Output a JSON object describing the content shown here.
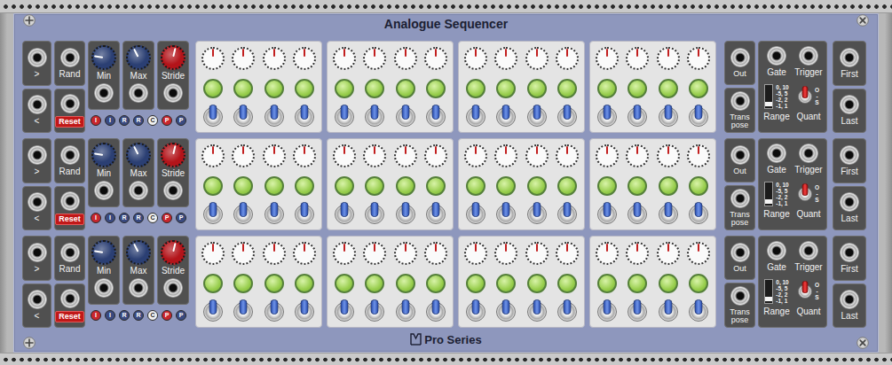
{
  "module": {
    "title": "Analogue Sequencer",
    "footer": "Pro Series"
  },
  "channels": [
    {
      "inputs": [
        {
          "label": ">"
        },
        {
          "label": "<"
        }
      ],
      "controls": [
        {
          "label": "Rand",
          "kind": "plain"
        },
        {
          "label": "Reset",
          "kind": "pill"
        }
      ],
      "knobs": [
        {
          "label": "Min",
          "level": 0.2,
          "color": "#2b3f73"
        },
        {
          "label": "Max",
          "level": 0.4,
          "color": "#2b3f73"
        },
        {
          "label": "Stride",
          "level": 0.55,
          "color": "#b3141a"
        }
      ],
      "indicators": [
        {
          "label": "I",
          "color": "#c8262d"
        },
        {
          "label": "I",
          "color": "#3a4a80"
        },
        {
          "label": "R",
          "color": "#3a4a80"
        },
        {
          "label": "R",
          "color": "#3a4a80"
        },
        {
          "label": "C",
          "color": "#f2f2f2"
        },
        {
          "label": "P",
          "color": "#c8262d"
        },
        {
          "label": "P",
          "color": "#3a4a80"
        }
      ],
      "groups": [
        {
          "steps": [
            {
              "level": 0.5,
              "lit": true,
              "switch": "up"
            },
            {
              "level": 0.5,
              "lit": true,
              "switch": "up"
            },
            {
              "level": 0.5,
              "lit": true,
              "switch": "up"
            },
            {
              "level": 0.5,
              "lit": true,
              "switch": "up"
            }
          ]
        },
        {
          "steps": [
            {
              "level": 0.5,
              "lit": true,
              "switch": "up"
            },
            {
              "level": 0.5,
              "lit": true,
              "switch": "up"
            },
            {
              "level": 0.5,
              "lit": true,
              "switch": "up"
            },
            {
              "level": 0.5,
              "lit": true,
              "switch": "up"
            }
          ]
        },
        {
          "steps": [
            {
              "level": 0.5,
              "lit": true,
              "switch": "up"
            },
            {
              "level": 0.5,
              "lit": true,
              "switch": "up"
            },
            {
              "level": 0.5,
              "lit": true,
              "switch": "up"
            },
            {
              "level": 0.5,
              "lit": true,
              "switch": "up"
            }
          ]
        },
        {
          "steps": [
            {
              "level": 0.5,
              "lit": true,
              "switch": "up"
            },
            {
              "level": 0.5,
              "lit": true,
              "switch": "up"
            },
            {
              "level": 0.5,
              "lit": true,
              "switch": "up"
            },
            {
              "level": 0.5,
              "lit": true,
              "switch": "up"
            }
          ]
        }
      ],
      "outputs": [
        {
          "label": "Out"
        },
        {
          "label": "Trans pose"
        }
      ],
      "gates": [
        {
          "label": "Gate"
        },
        {
          "label": "Trigger"
        }
      ],
      "range": {
        "label": "Range",
        "options": [
          "0, 10",
          "-5, 5",
          "-2, 2",
          "-1, 1"
        ],
        "level": 0.1
      },
      "quant": {
        "label": "Quant",
        "marks": [
          "O",
          "-",
          "S"
        ],
        "position": "up"
      },
      "ends": [
        {
          "label": "First"
        },
        {
          "label": "Last"
        }
      ]
    },
    {
      "inputs": [
        {
          "label": ">"
        },
        {
          "label": "<"
        }
      ],
      "controls": [
        {
          "label": "Rand",
          "kind": "plain"
        },
        {
          "label": "Reset",
          "kind": "pill"
        }
      ],
      "knobs": [
        {
          "label": "Min",
          "level": 0.2,
          "color": "#2b3f73"
        },
        {
          "label": "Max",
          "level": 0.4,
          "color": "#2b3f73"
        },
        {
          "label": "Stride",
          "level": 0.55,
          "color": "#b3141a"
        }
      ],
      "indicators": [
        {
          "label": "I",
          "color": "#c8262d"
        },
        {
          "label": "I",
          "color": "#3a4a80"
        },
        {
          "label": "R",
          "color": "#3a4a80"
        },
        {
          "label": "R",
          "color": "#3a4a80"
        },
        {
          "label": "C",
          "color": "#f2f2f2"
        },
        {
          "label": "P",
          "color": "#c8262d"
        },
        {
          "label": "P",
          "color": "#3a4a80"
        }
      ],
      "groups": [
        {
          "steps": [
            {
              "level": 0.5,
              "lit": true,
              "switch": "up"
            },
            {
              "level": 0.5,
              "lit": true,
              "switch": "up"
            },
            {
              "level": 0.5,
              "lit": true,
              "switch": "up"
            },
            {
              "level": 0.5,
              "lit": true,
              "switch": "up"
            }
          ]
        },
        {
          "steps": [
            {
              "level": 0.5,
              "lit": true,
              "switch": "up"
            },
            {
              "level": 0.5,
              "lit": true,
              "switch": "up"
            },
            {
              "level": 0.5,
              "lit": true,
              "switch": "up"
            },
            {
              "level": 0.5,
              "lit": true,
              "switch": "up"
            }
          ]
        },
        {
          "steps": [
            {
              "level": 0.5,
              "lit": true,
              "switch": "up"
            },
            {
              "level": 0.5,
              "lit": true,
              "switch": "up"
            },
            {
              "level": 0.5,
              "lit": true,
              "switch": "up"
            },
            {
              "level": 0.5,
              "lit": true,
              "switch": "up"
            }
          ]
        },
        {
          "steps": [
            {
              "level": 0.5,
              "lit": true,
              "switch": "up"
            },
            {
              "level": 0.5,
              "lit": true,
              "switch": "up"
            },
            {
              "level": 0.5,
              "lit": true,
              "switch": "up"
            },
            {
              "level": 0.5,
              "lit": true,
              "switch": "up"
            }
          ]
        }
      ],
      "outputs": [
        {
          "label": "Out"
        },
        {
          "label": "Trans pose"
        }
      ],
      "gates": [
        {
          "label": "Gate"
        },
        {
          "label": "Trigger"
        }
      ],
      "range": {
        "label": "Range",
        "options": [
          "0, 10",
          "-5, 5",
          "-2, 2",
          "-1, 1"
        ],
        "level": 0.1
      },
      "quant": {
        "label": "Quant",
        "marks": [
          "O",
          "-",
          "S"
        ],
        "position": "up"
      },
      "ends": [
        {
          "label": "First"
        },
        {
          "label": "Last"
        }
      ]
    },
    {
      "inputs": [
        {
          "label": ">"
        },
        {
          "label": "<"
        }
      ],
      "controls": [
        {
          "label": "Rand",
          "kind": "plain"
        },
        {
          "label": "Reset",
          "kind": "pill"
        }
      ],
      "knobs": [
        {
          "label": "Min",
          "level": 0.2,
          "color": "#2b3f73"
        },
        {
          "label": "Max",
          "level": 0.4,
          "color": "#2b3f73"
        },
        {
          "label": "Stride",
          "level": 0.55,
          "color": "#b3141a"
        }
      ],
      "indicators": [
        {
          "label": "I",
          "color": "#c8262d"
        },
        {
          "label": "I",
          "color": "#3a4a80"
        },
        {
          "label": "R",
          "color": "#3a4a80"
        },
        {
          "label": "R",
          "color": "#3a4a80"
        },
        {
          "label": "C",
          "color": "#f2f2f2"
        },
        {
          "label": "P",
          "color": "#c8262d"
        },
        {
          "label": "P",
          "color": "#3a4a80"
        }
      ],
      "groups": [
        {
          "steps": [
            {
              "level": 0.5,
              "lit": true,
              "switch": "up"
            },
            {
              "level": 0.5,
              "lit": true,
              "switch": "up"
            },
            {
              "level": 0.5,
              "lit": true,
              "switch": "up"
            },
            {
              "level": 0.5,
              "lit": true,
              "switch": "up"
            }
          ]
        },
        {
          "steps": [
            {
              "level": 0.5,
              "lit": true,
              "switch": "up"
            },
            {
              "level": 0.5,
              "lit": true,
              "switch": "up"
            },
            {
              "level": 0.5,
              "lit": true,
              "switch": "up"
            },
            {
              "level": 0.5,
              "lit": true,
              "switch": "up"
            }
          ]
        },
        {
          "steps": [
            {
              "level": 0.5,
              "lit": true,
              "switch": "up"
            },
            {
              "level": 0.5,
              "lit": true,
              "switch": "up"
            },
            {
              "level": 0.5,
              "lit": true,
              "switch": "up"
            },
            {
              "level": 0.5,
              "lit": true,
              "switch": "up"
            }
          ]
        },
        {
          "steps": [
            {
              "level": 0.5,
              "lit": true,
              "switch": "up"
            },
            {
              "level": 0.5,
              "lit": true,
              "switch": "up"
            },
            {
              "level": 0.5,
              "lit": true,
              "switch": "up"
            },
            {
              "level": 0.5,
              "lit": true,
              "switch": "up"
            }
          ]
        }
      ],
      "outputs": [
        {
          "label": "Out"
        },
        {
          "label": "Trans pose"
        }
      ],
      "gates": [
        {
          "label": "Gate"
        },
        {
          "label": "Trigger"
        }
      ],
      "range": {
        "label": "Range",
        "options": [
          "0, 10",
          "-5, 5",
          "-2, 2",
          "-1, 1"
        ],
        "level": 0.1
      },
      "quant": {
        "label": "Quant",
        "marks": [
          "O",
          "-",
          "S"
        ],
        "position": "up"
      },
      "ends": [
        {
          "label": "First"
        },
        {
          "label": "Last"
        }
      ]
    }
  ]
}
